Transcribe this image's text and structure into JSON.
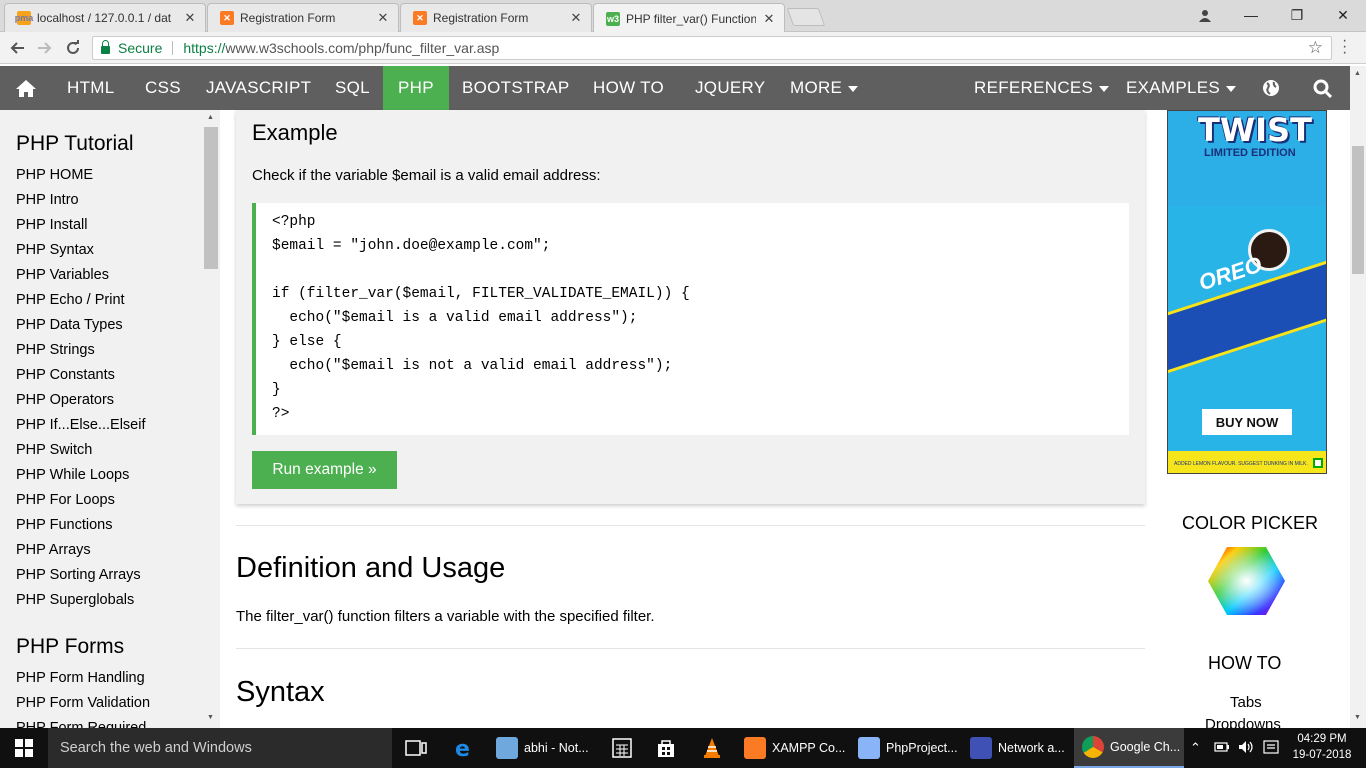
{
  "browser": {
    "tabs": [
      {
        "title": "localhost / 127.0.0.1 / dat",
        "icon": "phpmyadmin-icon",
        "active": false
      },
      {
        "title": "Registration Form",
        "icon": "xampp-icon",
        "active": false
      },
      {
        "title": "Registration Form",
        "icon": "xampp-icon",
        "active": false
      },
      {
        "title": "PHP filter_var() Function",
        "icon": "w3schools-icon",
        "active": true
      }
    ],
    "tab_close": "✕",
    "window_controls": {
      "minimize": "—",
      "maximize": "❐",
      "close": "✕"
    },
    "secure_label": "Secure",
    "url_scheme": "https://",
    "url_rest": "www.w3schools.com/php/func_filter_var.asp"
  },
  "topnav": {
    "items": [
      "HTML",
      "CSS",
      "JAVASCRIPT",
      "SQL",
      "PHP",
      "BOOTSTRAP",
      "HOW TO",
      "JQUERY",
      "MORE",
      "REFERENCES",
      "EXAMPLES"
    ],
    "active": "PHP",
    "accent": "#4caf50",
    "bg": "#5f5f5f"
  },
  "sidebar": {
    "heading1": "PHP Tutorial",
    "links1": [
      "PHP HOME",
      "PHP Intro",
      "PHP Install",
      "PHP Syntax",
      "PHP Variables",
      "PHP Echo / Print",
      "PHP Data Types",
      "PHP Strings",
      "PHP Constants",
      "PHP Operators",
      "PHP If...Else...Elseif",
      "PHP Switch",
      "PHP While Loops",
      "PHP For Loops",
      "PHP Functions",
      "PHP Arrays",
      "PHP Sorting Arrays",
      "PHP Superglobals"
    ],
    "heading2": "PHP Forms",
    "links2": [
      "PHP Form Handling",
      "PHP Form Validation",
      "PHP Form Required"
    ]
  },
  "example": {
    "title": "Example",
    "text": "Check if the variable $email is a valid email address:",
    "code": [
      "<?php",
      "$email = \"john.doe@example.com\";",
      "",
      "if (filter_var($email, FILTER_VALIDATE_EMAIL)) {",
      "  echo(\"$email is a valid email address\");",
      "} else {",
      "  echo(\"$email is not a valid email address\");",
      "}",
      "?>"
    ],
    "run_button": "Run example »"
  },
  "definition": {
    "heading": "Definition and Usage",
    "text": "The filter_var() function filters a variable with the specified filter."
  },
  "syntax": {
    "heading": "Syntax"
  },
  "ad": {
    "word": "TWIST",
    "limited": "LIMITED EDITION",
    "brand": "OREO",
    "button": "BUY NOW",
    "small": "ADDED LEMON FLAVOUR. SUGGEST DUNKING IN MILK."
  },
  "right": {
    "color_picker": "COLOR PICKER",
    "how_to": "HOW TO",
    "links": [
      "Tabs",
      "Dropdowns"
    ]
  },
  "taskbar": {
    "search_placeholder": "Search the web and Windows",
    "apps": [
      "abhi - Not...",
      "XAMPP Co...",
      "PhpProject...",
      "Network a...",
      "Google Ch..."
    ],
    "time": "04:29 PM",
    "date": "19-07-2018"
  }
}
